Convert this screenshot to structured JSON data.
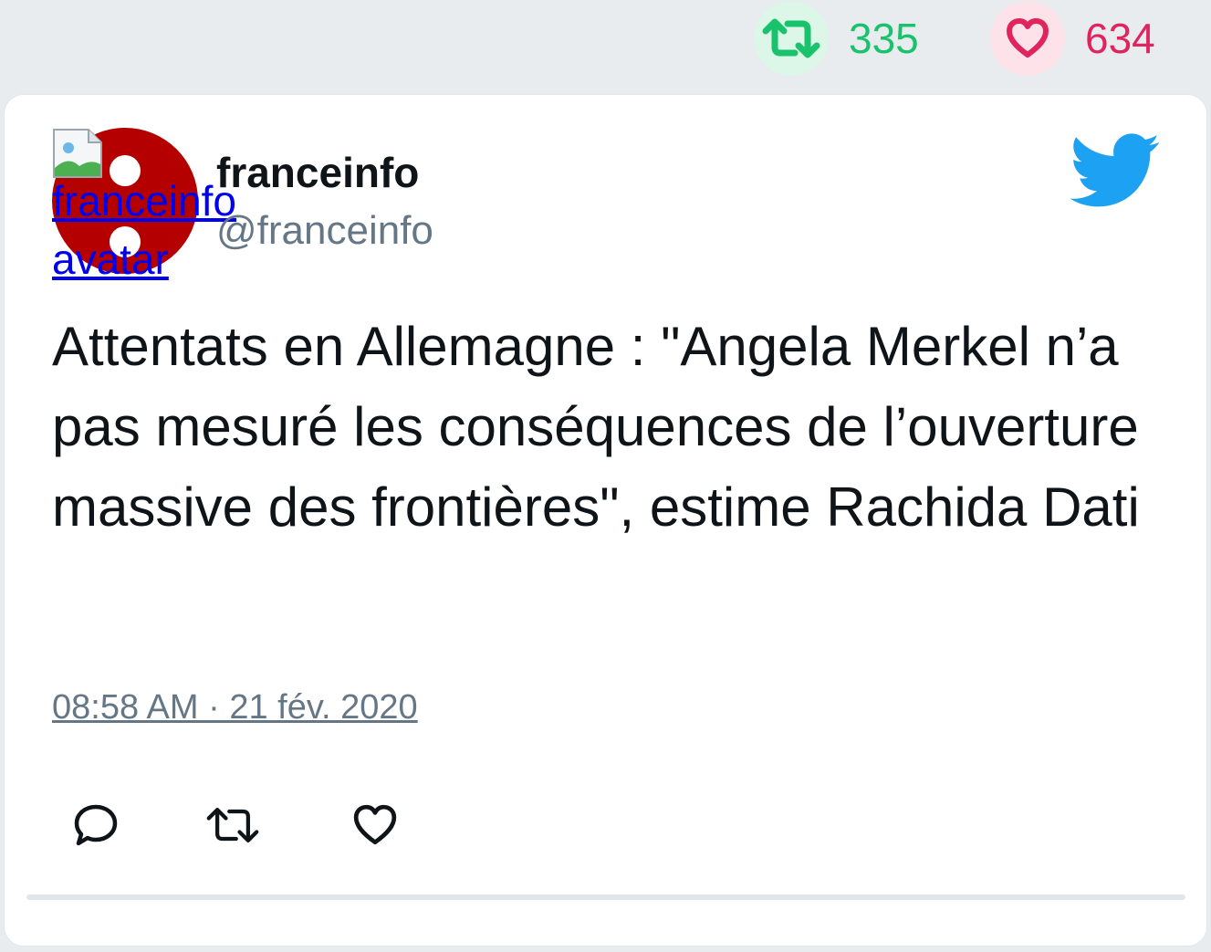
{
  "stats": {
    "retweets": "335",
    "likes": "634",
    "retweet_icon": "retweet-icon",
    "like_icon": "heart-icon",
    "retweet_color": "#19c36c",
    "like_color": "#e0245e"
  },
  "tweet": {
    "avatar_alt": "franceinfo avatar",
    "author_name": "franceinfo",
    "author_handle": "@franceinfo",
    "platform_icon": "twitter-bird-icon",
    "text": "Attentats en Allemagne : \"Angela Merkel n’a pas mesuré les conséquences de l’ouverture massive des frontières\", estime Rachida Dati",
    "timestamp": "08:58 AM · 21 fév. 2020",
    "actions": [
      {
        "icon": "reply-icon"
      },
      {
        "icon": "retweet-icon"
      },
      {
        "icon": "heart-icon"
      }
    ]
  },
  "colors": {
    "brand_blue": "#1da1f2",
    "avatar_red": "#b50000",
    "muted_text": "#657786"
  }
}
